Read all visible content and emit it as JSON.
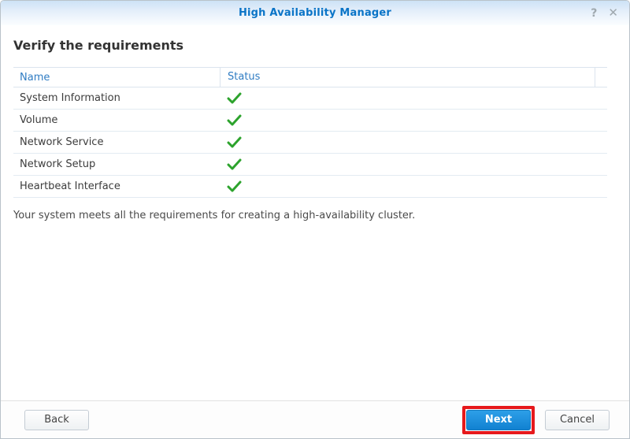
{
  "titlebar": {
    "title": "High Availability Manager",
    "help_icon": "?",
    "close_icon": "✕"
  },
  "page": {
    "heading": "Verify the requirements",
    "message": "Your system meets all the requirements for creating a high-availability cluster."
  },
  "table": {
    "columns": [
      "Name",
      "Status"
    ],
    "rows": [
      {
        "name": "System Information",
        "status": "pass"
      },
      {
        "name": "Volume",
        "status": "pass"
      },
      {
        "name": "Network Service",
        "status": "pass"
      },
      {
        "name": "Network Setup",
        "status": "pass"
      },
      {
        "name": "Heartbeat Interface",
        "status": "pass"
      }
    ]
  },
  "footer": {
    "back_label": "Back",
    "next_label": "Next",
    "cancel_label": "Cancel"
  },
  "colors": {
    "title_blue": "#0a74c7",
    "column_header_blue": "#2f7cc3",
    "check_green": "#2da32d",
    "next_button_blue": "#1181d1",
    "annotation_red": "#e6191c"
  }
}
